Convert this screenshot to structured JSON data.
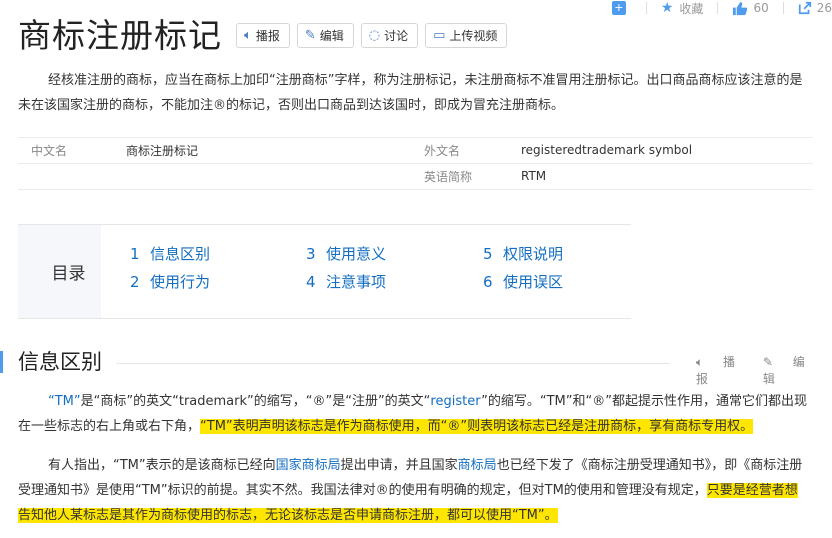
{
  "topbar": {
    "add_icon": "plus-icon",
    "collect_label": "收藏",
    "like_count": "60",
    "share_count": "26"
  },
  "header": {
    "title": "商标注册标记",
    "buttons": [
      {
        "label": "播报",
        "icon": "speaker-icon"
      },
      {
        "label": "编辑",
        "icon": "pen-icon"
      },
      {
        "label": "讨论",
        "icon": "chat-icon"
      },
      {
        "label": "上传视频",
        "icon": "video-icon"
      }
    ]
  },
  "lead": "经核准注册的商标，应当在商标上加印“注册商标”字样，称为注册标记，未注册商标不准冒用注册标记。出口商品商标应该注意的是未在该国家注册的商标，不能加注®的标记，否则出口商品到达该国时，即成为冒充注册商标。",
  "basic_info": {
    "row1": {
      "k1": "中文名",
      "v1": "商标注册标记",
      "k2": "外文名",
      "v2": "registeredtrademark symbol"
    },
    "row2": {
      "k2": "英语简称",
      "v2": "RTM"
    }
  },
  "catalog": {
    "label": "目录",
    "items": [
      {
        "num": "1",
        "text": "信息区别"
      },
      {
        "num": "2",
        "text": "使用行为"
      },
      {
        "num": "3",
        "text": "使用意义"
      },
      {
        "num": "4",
        "text": "注意事项"
      },
      {
        "num": "5",
        "text": "权限说明"
      },
      {
        "num": "6",
        "text": "使用误区"
      }
    ]
  },
  "section": {
    "title": "信息区别",
    "broadcast": "播报",
    "edit": "编辑"
  },
  "p1": {
    "a": "“TM”",
    "b": "是“商标”的英文“trademark”的缩写，“®”是“注册”的英文“",
    "c": "register",
    "d": "”的缩写。“TM”和“®”都起提示性作用，通常它们都出现在一些标志的右上角或右下角，",
    "e": "“TM”表明声明该标志是作为商标使用，而“®”则表明该标志已经是注册商标，享有商标专用权。"
  },
  "p2": {
    "a": "有人指出，“TM”表示的是该商标已经向",
    "b": "国家商标局",
    "c": "提出申请，并且国家",
    "d": "商标局",
    "e": "也已经下发了《商标注册受理通知书》，即《商标注册受理通知书》是使用“TM”标识的前提。其实不然。我国法律对®的使用有明确的规定，但对TM的使用和管理没有规定，",
    "f": "只要是经营者想告知他人某标志是其作为商标使用的标志，无论该标志是否申请商标注册，都可以使用“TM”。"
  }
}
